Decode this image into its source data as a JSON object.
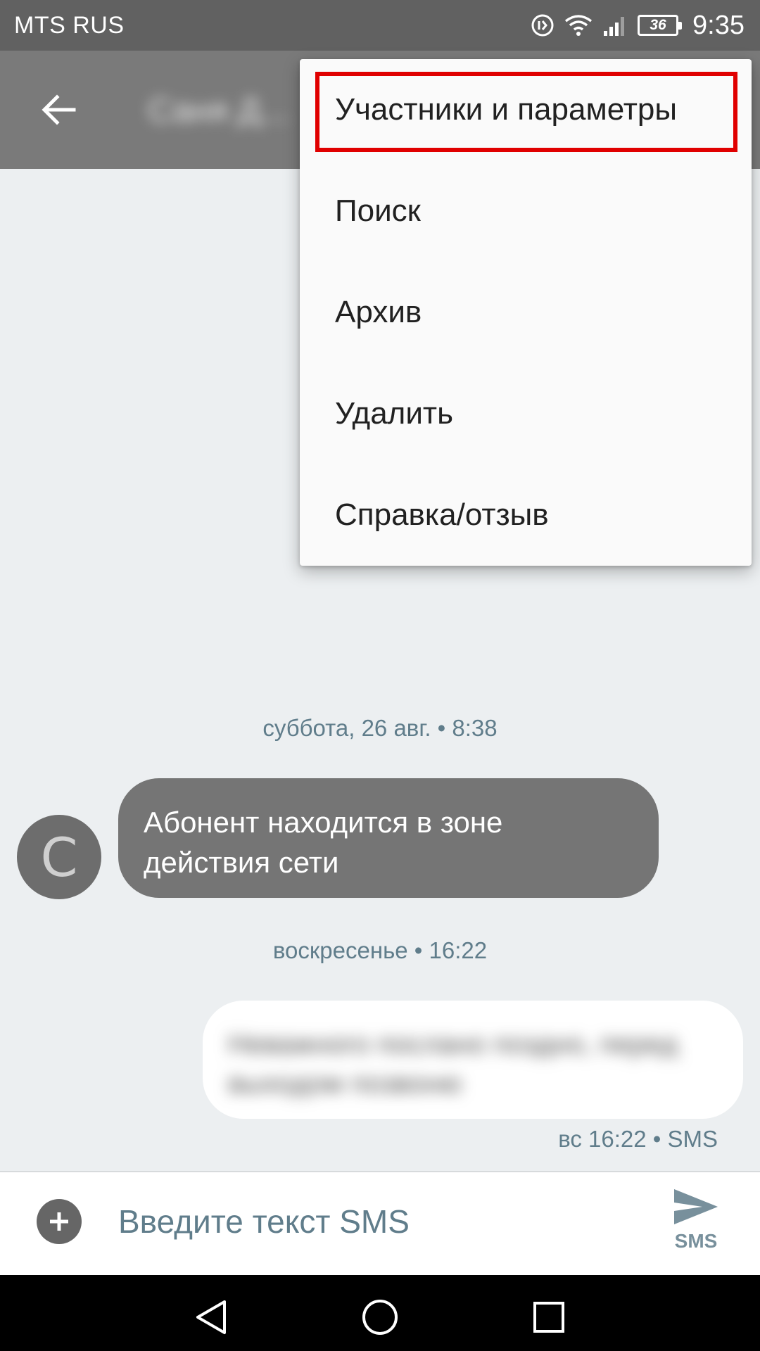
{
  "status_bar": {
    "carrier": "MTS RUS",
    "battery": "36",
    "time": "9:35"
  },
  "app_bar": {
    "contact_name": "Саня Д..."
  },
  "menu": {
    "items": [
      {
        "label": "Участники и параметры"
      },
      {
        "label": "Поиск"
      },
      {
        "label": "Архив"
      },
      {
        "label": "Удалить"
      },
      {
        "label": "Справка/отзыв"
      }
    ]
  },
  "conversation": {
    "date_1": "суббота, 26 авг. • 8:38",
    "avatar_letter": "C",
    "incoming_text": "Абонент находится в зоне действия сети",
    "date_2": "воскресенье • 16:22",
    "outgoing_text": "Неважного поcлано поздно, перед выходом позвоню",
    "outgoing_meta": "вс 16:22 • SMS"
  },
  "compose": {
    "placeholder": "Введите текст SMS",
    "send_label": "SMS"
  },
  "colors": {
    "highlight": "#e00000",
    "status_bar": "#616161",
    "app_bar": "#7a7a7a",
    "incoming_bubble": "#757575",
    "accent_text": "#607d8b"
  }
}
